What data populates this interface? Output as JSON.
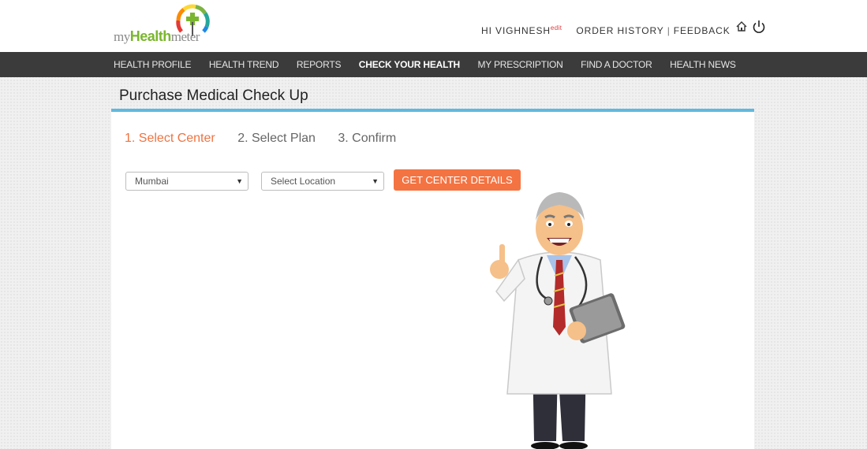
{
  "header": {
    "logo": {
      "prefix": "my",
      "highlight": "Health",
      "suffix": "meter"
    },
    "greeting": "HI VIGHNESH",
    "edit_label": "edit",
    "order_history": "ORDER HISTORY",
    "separator": "|",
    "feedback": "FEEDBACK",
    "icons": [
      "home-icon",
      "power-icon"
    ]
  },
  "nav": {
    "items": [
      {
        "label": "HEALTH PROFILE"
      },
      {
        "label": "HEALTH TREND"
      },
      {
        "label": "REPORTS"
      },
      {
        "label": "CHECK YOUR HEALTH",
        "active": true
      },
      {
        "label": "MY PRESCRIPTION"
      },
      {
        "label": "FIND A DOCTOR"
      },
      {
        "label": "HEALTH NEWS"
      }
    ]
  },
  "page": {
    "title": "Purchase Medical Check Up",
    "steps": [
      {
        "label": "1. Select Center",
        "active": true
      },
      {
        "label": "2. Select Plan"
      },
      {
        "label": "3. Confirm"
      }
    ],
    "city_select": {
      "value": "Mumbai"
    },
    "location_select": {
      "value": "Select Location"
    },
    "button_label": "GET CENTER DETAILS"
  },
  "colors": {
    "accent": "#f47342",
    "nav_bg": "#3b3b3b",
    "rule": "#5fb9df",
    "logo_green": "#7ab62e",
    "edit_red": "#e0343a"
  }
}
